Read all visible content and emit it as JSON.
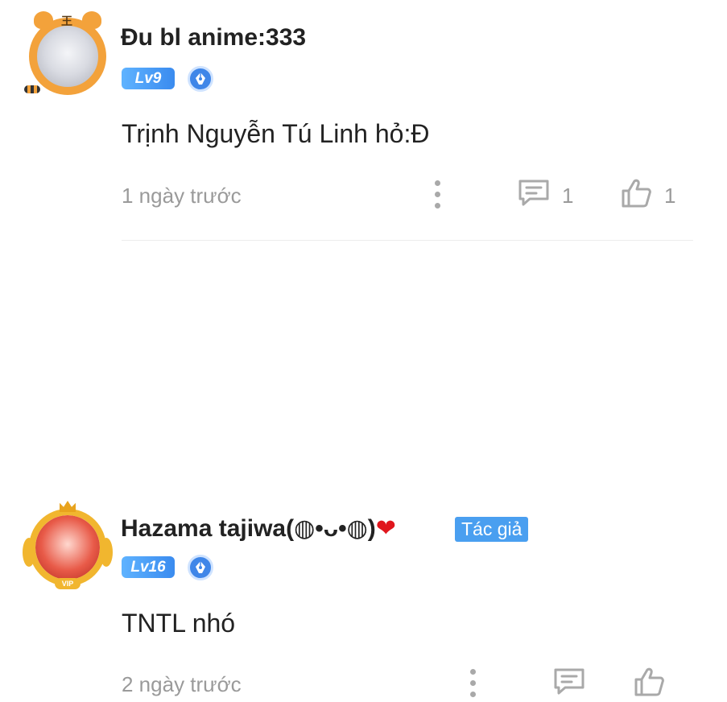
{
  "comments": [
    {
      "username": "Đu bl anime:333",
      "level": "Lv9",
      "content": "Trịnh Nguyễn Tú Linh hỏ:Đ",
      "time": "1 ngày trước",
      "reply_count": "1",
      "like_count": "1",
      "avatar_frame": "tiger-frame",
      "avatar_mark": "王"
    },
    {
      "username": "Hazama tajiwa(◍•ᴗ•◍)",
      "username_emoji": "❤",
      "author_badge": "Tác giả",
      "level": "Lv16",
      "content": "TNTL nhó",
      "time": "2 ngày trước",
      "reply_count": "",
      "like_count": "",
      "avatar_frame": "vip-frame",
      "avatar_tag": "VIP"
    }
  ],
  "colors": {
    "accent": "#3f86e8",
    "badge_blue": "#4a9ff0",
    "text_primary": "#222222",
    "text_secondary": "#9a9a9a",
    "heart": "#e0161d"
  },
  "icons": {
    "more": "more-vertical-icon",
    "reply": "comment-reply-icon",
    "like": "thumbs-up-icon",
    "pen": "fountain-pen-icon"
  }
}
